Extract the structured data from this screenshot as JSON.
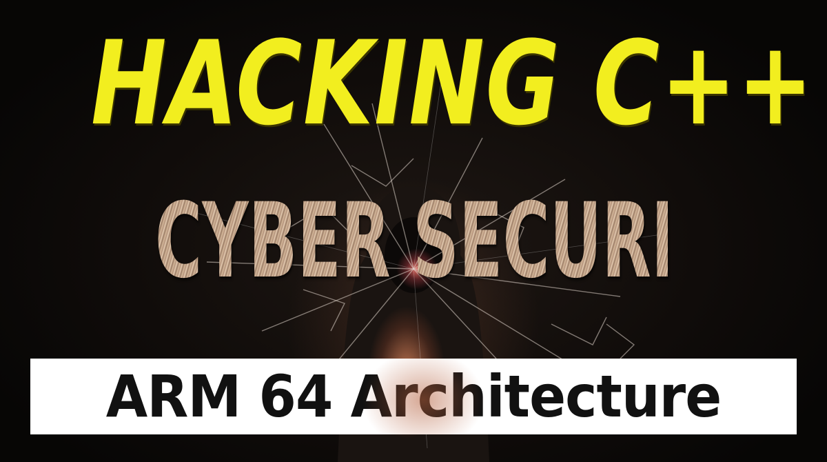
{
  "title": "HACKING C++",
  "subtitle": "CYBER SECURITY",
  "banner": {
    "text": "ARM 64 Architecture"
  },
  "colors": {
    "title": "#f2ee1f",
    "background": "#100c0a",
    "banner_bg": "#ffffff",
    "banner_text": "#111111"
  }
}
